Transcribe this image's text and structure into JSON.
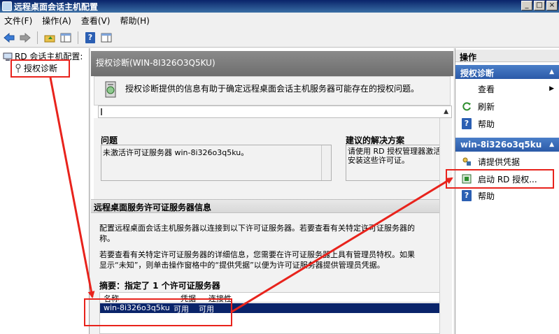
{
  "window": {
    "title": "远程桌面会话主机配置",
    "buttons": [
      "_",
      "□",
      "×"
    ]
  },
  "menu": [
    "文件(F)",
    "操作(A)",
    "查看(V)",
    "帮助(H)"
  ],
  "tree": {
    "root": "RD 会话主机配置:",
    "child": "授权诊断"
  },
  "center": {
    "header": "授权诊断(WIN-8I326O3Q5KU)",
    "description": "授权诊断提供的信息有助于确定远程桌面会话主机服务器可能存在的授权问题。",
    "problem_label": "问题",
    "solution_label": "建议的解决方案",
    "problem_text": "未激活许可证服务器 win-8i326o3q5ku。",
    "solution_text": "请使用 RD 授权管理器激活 安装这些许可证。",
    "section_title": "远程桌面服务许可证服务器信息",
    "para1_line1": "配置远程桌面会话主机服务器以连接到以下许可证服务器。若要查看有关特定许可证服务器的",
    "para1_line2": "称。",
    "para2_line1": "若要查看有关特定许可证服务器的详细信息，您需要在许可证服务器上具有管理员特权。如果",
    "para2_line2": "显示“未知”，则单击操作窗格中的“提供凭据”以便为许可证服务器提供管理员凭据。",
    "summary": "摘要：指定了 1 个许可证服务器",
    "list_headers": [
      "名称",
      "凭据",
      "连接性"
    ],
    "list_rows": [
      [
        "win-8i326o3q5ku",
        "可用",
        "可用"
      ]
    ]
  },
  "actions": {
    "title": "操作",
    "group1": "授权诊断",
    "group1_items": [
      "查看",
      "刷新",
      "帮助"
    ],
    "group2": "win-8i326o3q5ku",
    "group2_items": [
      "请提供凭据",
      "启动 RD 授权...",
      "帮助"
    ]
  },
  "colors": {
    "annotation": "#e8231c",
    "selection": "#0a246a",
    "action_group": "#2b5aa8"
  }
}
